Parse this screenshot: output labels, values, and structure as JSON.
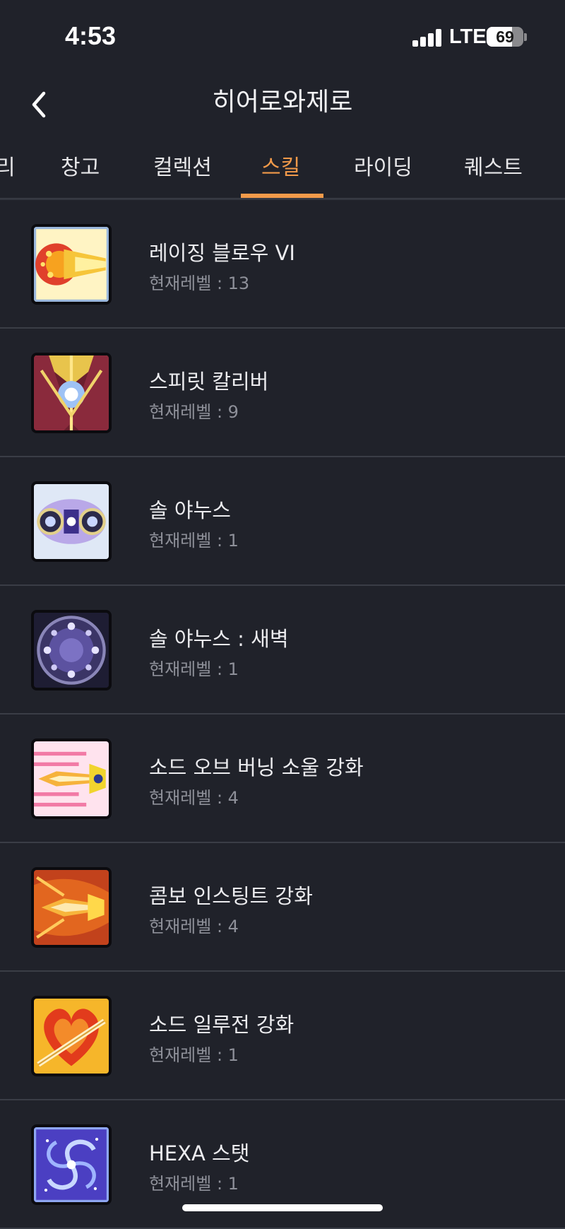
{
  "status_bar": {
    "time": "4:53",
    "network": "LTE",
    "battery": 69
  },
  "header": {
    "title": "히어로와제로"
  },
  "tabs": [
    {
      "label": "리"
    },
    {
      "label": "창고"
    },
    {
      "label": "컬렉션"
    },
    {
      "label": "스킬"
    },
    {
      "label": "라이딩"
    },
    {
      "label": "퀘스트"
    }
  ],
  "active_tab": "스킬",
  "accent_color": "#f29a4a",
  "skills": [
    {
      "name": "레이징 블로우 VI",
      "level": "현재레벨 : 13",
      "icon": "raging-blow-icon"
    },
    {
      "name": "스피릿 칼리버",
      "level": "현재레벨 : 9",
      "icon": "spirit-calibur-icon"
    },
    {
      "name": "솔 야누스",
      "level": "현재레벨 : 1",
      "icon": "sol-janus-icon"
    },
    {
      "name": "솔 야누스 : 새벽",
      "level": "현재레벨 : 1",
      "icon": "sol-janus-dawn-icon"
    },
    {
      "name": "소드 오브 버닝 소울 강화",
      "level": "현재레벨 : 4",
      "icon": "sword-burning-soul-icon"
    },
    {
      "name": "콤보 인스팅트 강화",
      "level": "현재레벨 : 4",
      "icon": "combo-instinct-icon"
    },
    {
      "name": "소드 일루전 강화",
      "level": "현재레벨 : 1",
      "icon": "sword-illusion-icon"
    },
    {
      "name": "HEXA 스탯",
      "level": "현재레벨 : 1",
      "icon": "hexa-stat-icon"
    }
  ]
}
